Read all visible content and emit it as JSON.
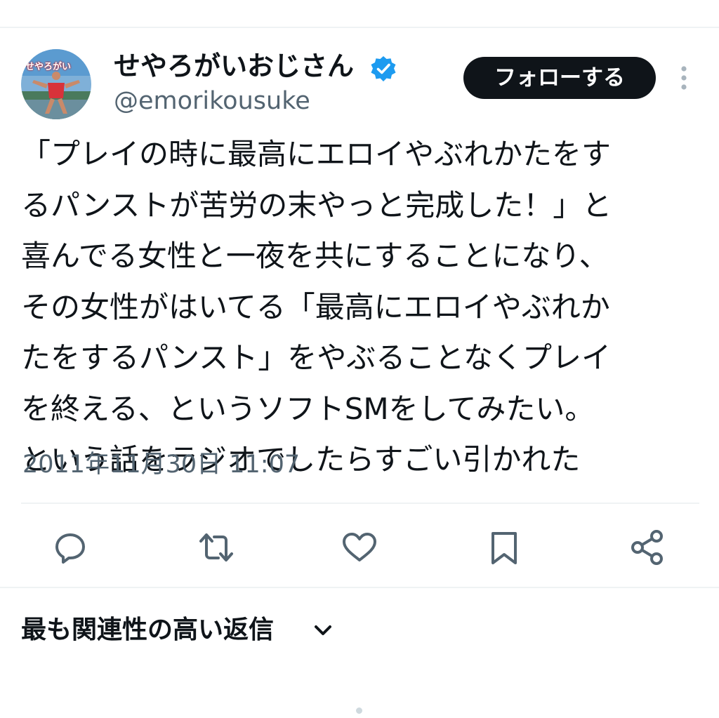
{
  "author": {
    "display_name": "せやろがいおじさん",
    "handle": "@emorikousuke",
    "verified": true,
    "avatar_text": "せやろがい"
  },
  "follow_button": {
    "label": "フォローする"
  },
  "tweet": {
    "lines": [
      "「プレイの時に最高にエロイやぶれかたをす",
      "るパンストが苦労の末やっと完成した！」と",
      "喜んでる女性と一夜を共にすることになり、",
      "その女性がはいてる「最高にエロイやぶれか",
      "たをするパンスト」をやぶることなくプレイ",
      "を終える、というソフトSMをしてみたい。",
      "という話をラジオでしたらすごい引かれた"
    ],
    "timestamp": "2011年11月30日 11:07"
  },
  "actions": [
    {
      "name": "reply",
      "icon": "speech-bubble-icon"
    },
    {
      "name": "retweet",
      "icon": "retweet-icon"
    },
    {
      "name": "like",
      "icon": "heart-icon"
    },
    {
      "name": "bookmark",
      "icon": "bookmark-icon"
    },
    {
      "name": "share",
      "icon": "share-icon"
    }
  ],
  "replies": {
    "sort_label": "最も関連性の高い返信"
  },
  "colors": {
    "text_primary": "#0f1419",
    "text_secondary": "#536471",
    "verified_blue": "#1d9bf0",
    "divider": "#eff3f4",
    "button_bg": "#0f1419"
  }
}
